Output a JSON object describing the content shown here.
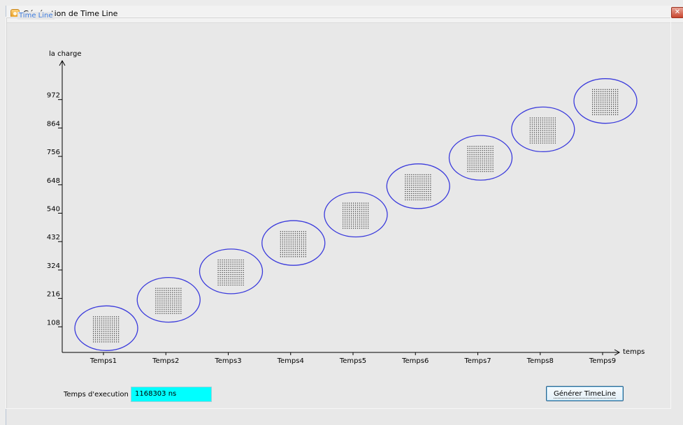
{
  "window": {
    "title": "Génération de Time Line",
    "close_glyph": "✕"
  },
  "group": {
    "title": "Time Line"
  },
  "chart_data": {
    "type": "scatter",
    "ylabel": "la charge",
    "xlabel": "temps",
    "categories": [
      "Temps1",
      "Temps2",
      "Temps3",
      "Temps4",
      "Temps5",
      "Temps6",
      "Temps7",
      "Temps8",
      "Temps9"
    ],
    "y_ticks": [
      "108",
      "216",
      "324",
      "432",
      "540",
      "648",
      "756",
      "864",
      "972"
    ],
    "values": [
      108,
      216,
      324,
      432,
      540,
      648,
      756,
      864,
      972
    ],
    "ylim": [
      0,
      1080
    ],
    "marker": "ellipse with dot-grid",
    "marker_color": "#3b3bdc"
  },
  "execution": {
    "label": "Temps d'execution",
    "value": "1168303 ns",
    "value_bg": "#00ffff"
  },
  "actions": {
    "generate_label": "Générer TimeLine"
  }
}
